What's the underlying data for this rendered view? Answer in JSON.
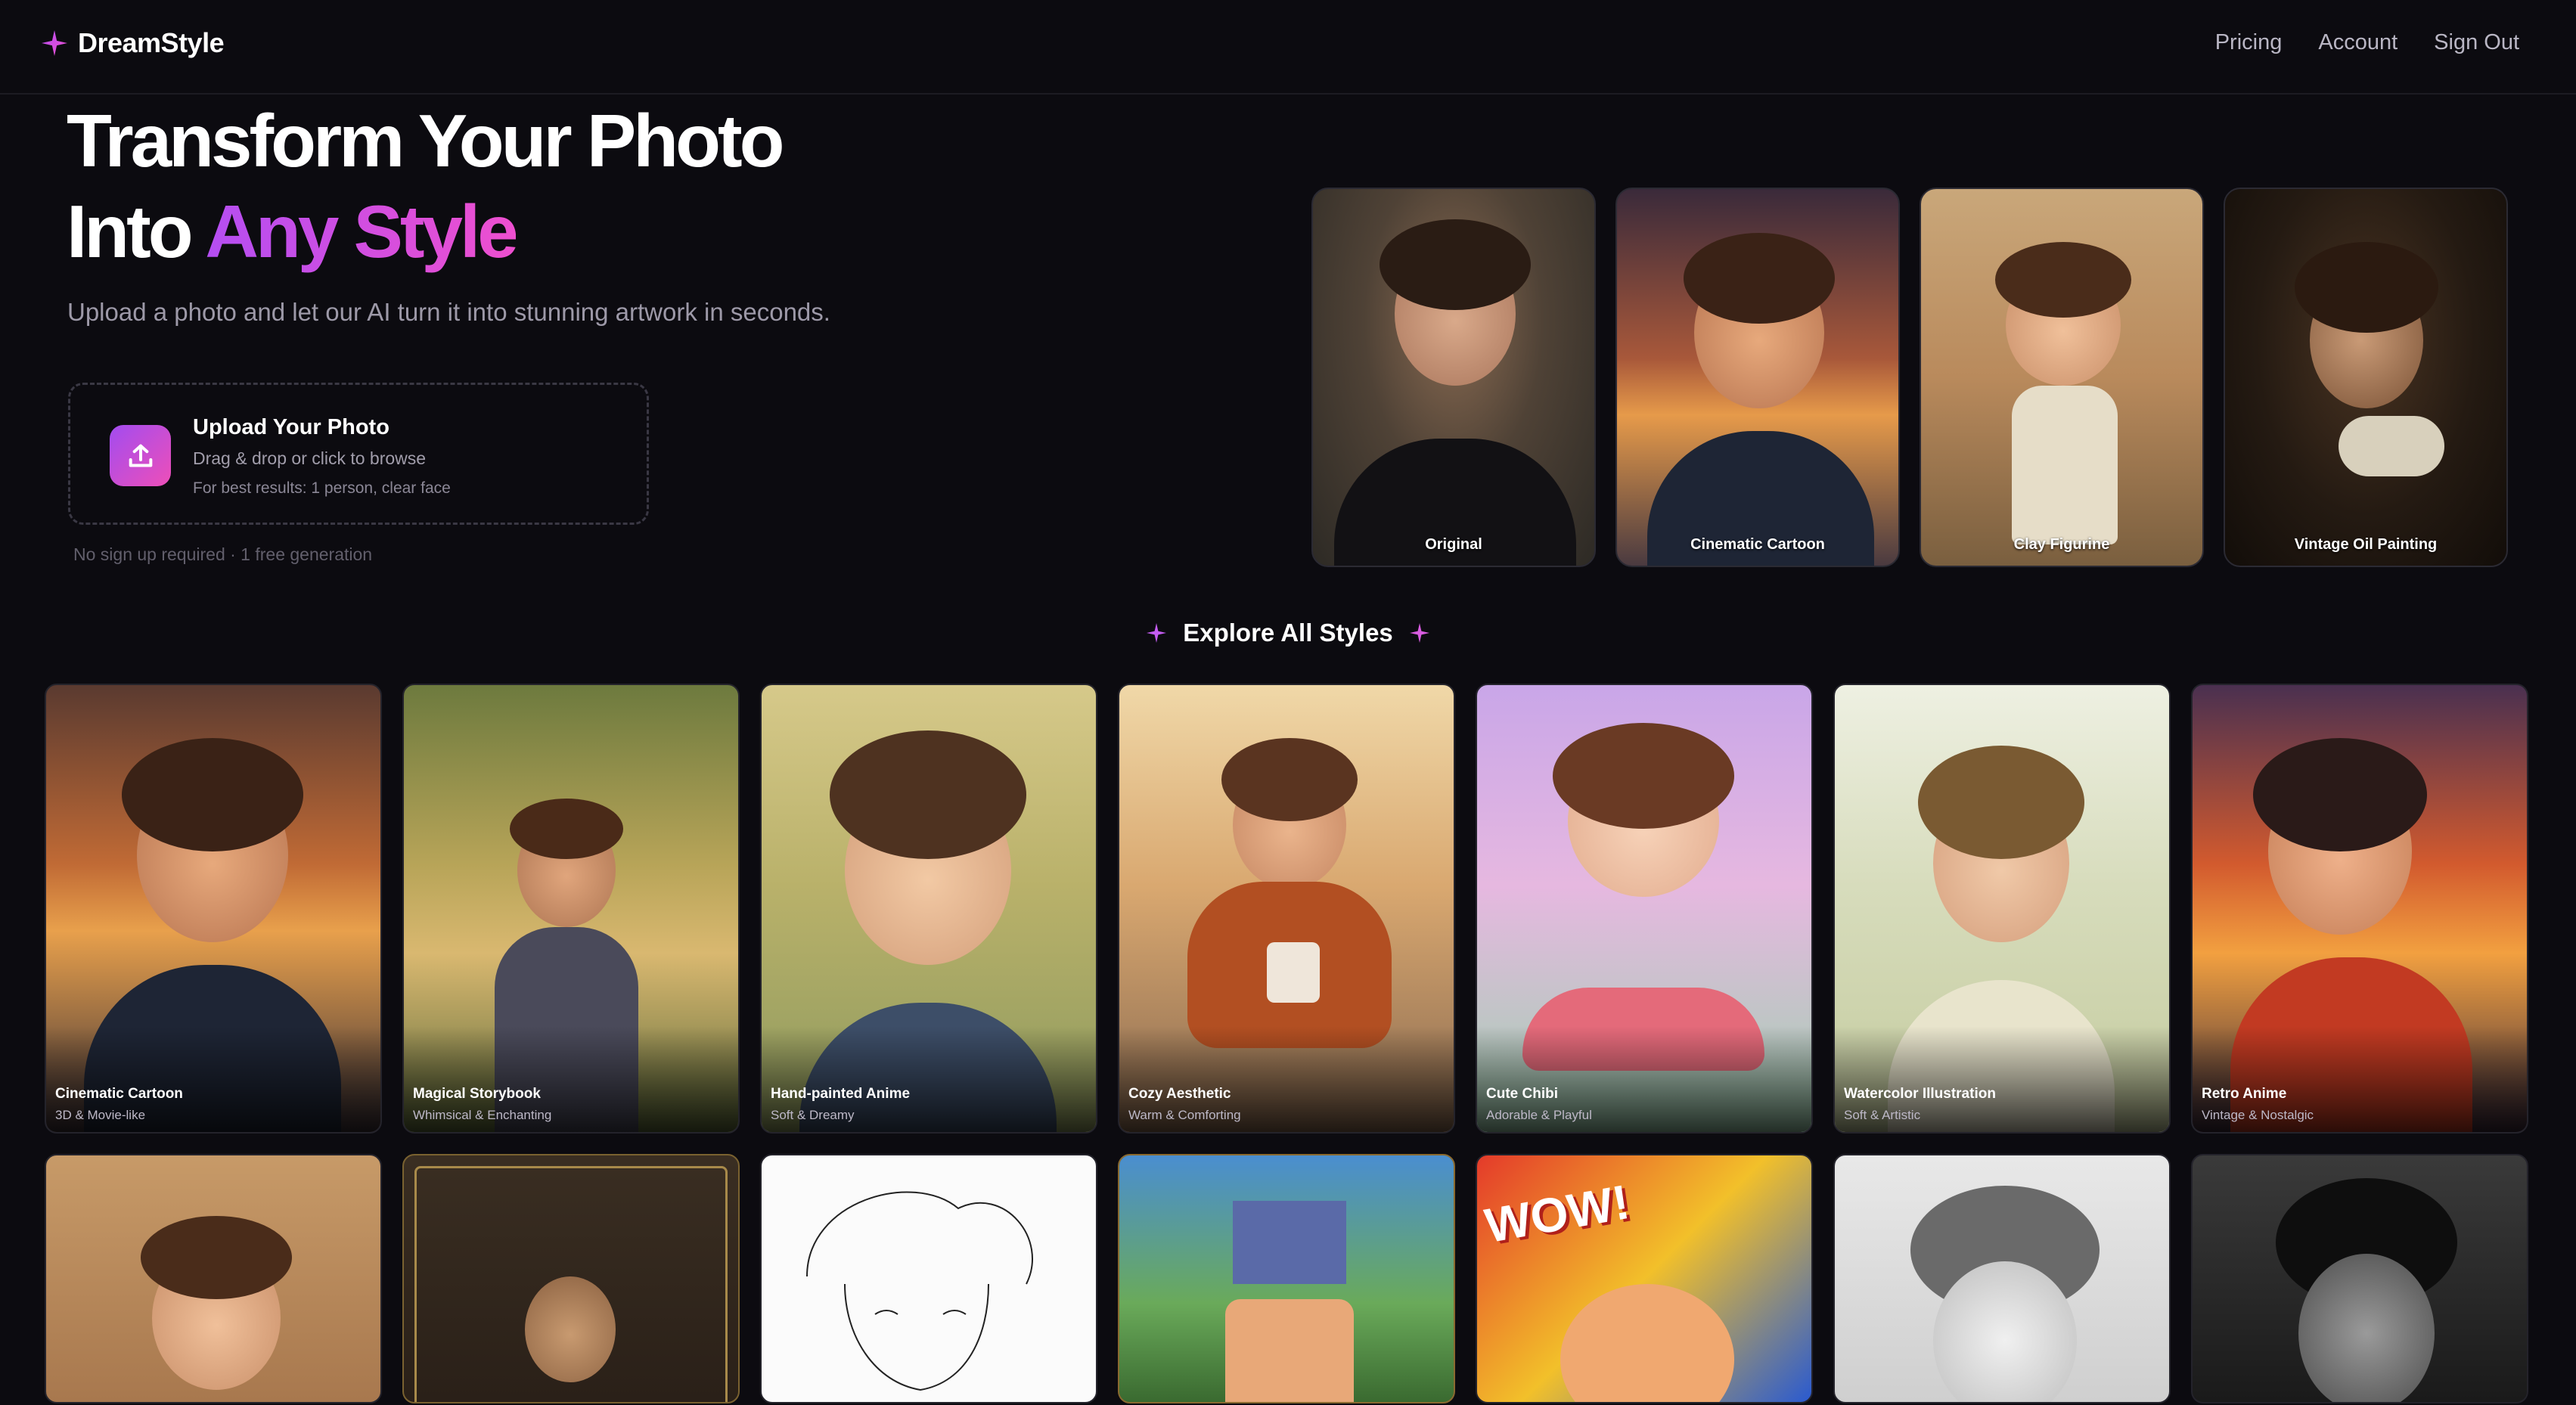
{
  "nav": {
    "brand": "DreamStyle",
    "links": [
      "Pricing",
      "Account",
      "Sign Out"
    ]
  },
  "hero": {
    "title_line1": "Transform Your Photo",
    "title_line2_plain": "Into ",
    "title_line2_accent": "Any Style",
    "subtitle": "Upload a photo and let our AI turn it into stunning artwork in seconds.",
    "upload": {
      "title": "Upload Your Photo",
      "subtitle": "Drag & drop or click to browse",
      "tip": "For best results: 1 person, clear face"
    },
    "note": "No sign up required · 1 free generation",
    "preview_cards": [
      "Original",
      "Cinematic Cartoon",
      "Clay Figurine",
      "Vintage Oil Painting"
    ]
  },
  "explore": {
    "title": "Explore All Styles",
    "styles": [
      {
        "name": "Cinematic Cartoon",
        "desc": "3D & Movie-like"
      },
      {
        "name": "Magical Storybook",
        "desc": "Whimsical & Enchanting"
      },
      {
        "name": "Hand-painted Anime",
        "desc": "Soft & Dreamy"
      },
      {
        "name": "Cozy Aesthetic",
        "desc": "Warm & Comforting"
      },
      {
        "name": "Cute Chibi",
        "desc": "Adorable & Playful"
      },
      {
        "name": "Watercolor Illustration",
        "desc": "Soft & Artistic"
      },
      {
        "name": "Retro Anime",
        "desc": "Vintage & Nostalgic"
      }
    ],
    "row2_count": 7
  },
  "colors": {
    "background": "#0c0b10",
    "accent_start": "#b44ef2",
    "accent_end": "#ee4fcf"
  }
}
